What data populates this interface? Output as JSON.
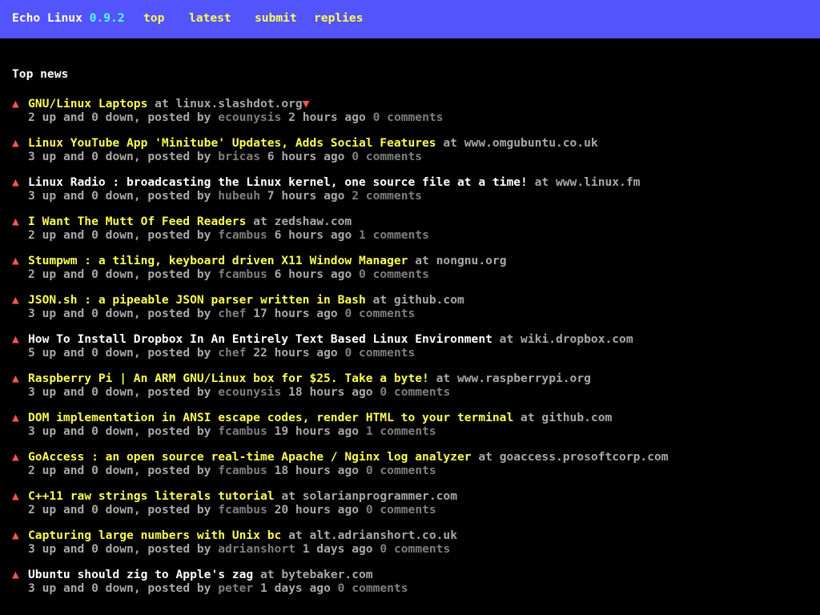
{
  "header": {
    "brand": "Echo Linux",
    "version": "0.9.2",
    "nav": [
      "top",
      "latest",
      "submit",
      "replies"
    ]
  },
  "section_title": "Top news",
  "colors": {
    "header_bg": "#5454fc",
    "link_yellow": "#fcfc54",
    "vote_red": "#fc5454",
    "version_cyan": "#54fcfc",
    "meta_gray": "#a8a8a8",
    "dim_gray": "#7f7f7f"
  },
  "icons": {
    "upvote": "▲",
    "downvote": "▼"
  },
  "news": [
    {
      "title": "GNU/Linux Laptops",
      "domain": "linux.slashdot.org",
      "white": false,
      "downvote": true,
      "up": "2",
      "down": "0",
      "user": "ecounysis",
      "time": "2 hours ago",
      "comments": "0 comments"
    },
    {
      "title": "Linux YouTube App 'Minitube' Updates, Adds Social Features",
      "domain": "www.omgubuntu.co.uk",
      "white": false,
      "downvote": false,
      "up": "3",
      "down": "0",
      "user": "bricas",
      "time": "6 hours ago",
      "comments": "0 comments"
    },
    {
      "title": "Linux Radio : broadcasting the Linux kernel, one source file at a time!",
      "domain": "www.linux.fm",
      "white": true,
      "downvote": false,
      "up": "3",
      "down": "0",
      "user": "hubeuh",
      "time": "7 hours ago",
      "comments": "2 comments"
    },
    {
      "title": "I Want The Mutt Of Feed Readers",
      "domain": "zedshaw.com",
      "white": false,
      "downvote": false,
      "up": "2",
      "down": "0",
      "user": "fcambus",
      "time": "6 hours ago",
      "comments": "1 comments"
    },
    {
      "title": "Stumpwm : a tiling, keyboard driven X11 Window Manager",
      "domain": "nongnu.org",
      "white": false,
      "downvote": false,
      "up": "2",
      "down": "0",
      "user": "fcambus",
      "time": "6 hours ago",
      "comments": "0 comments"
    },
    {
      "title": "JSON.sh : a pipeable JSON parser written in Bash",
      "domain": "github.com",
      "white": false,
      "downvote": false,
      "up": "3",
      "down": "0",
      "user": "chef",
      "time": "17 hours ago",
      "comments": "0 comments"
    },
    {
      "title": "How To Install Dropbox In An Entirely Text Based Linux Environment",
      "domain": "wiki.dropbox.com",
      "white": true,
      "downvote": false,
      "up": "5",
      "down": "0",
      "user": "chef",
      "time": "22 hours ago",
      "comments": "0 comments"
    },
    {
      "title": "Raspberry Pi | An ARM GNU/Linux box for $25. Take a byte!",
      "domain": "www.raspberrypi.org",
      "white": false,
      "downvote": false,
      "up": "3",
      "down": "0",
      "user": "ecounysis",
      "time": "18 hours ago",
      "comments": "0 comments"
    },
    {
      "title": "DOM implementation in ANSI escape codes, render HTML to your terminal",
      "domain": "github.com",
      "white": false,
      "downvote": false,
      "up": "3",
      "down": "0",
      "user": "fcambus",
      "time": "19 hours ago",
      "comments": "1 comments"
    },
    {
      "title": "GoAccess : an open source real-time Apache / Nginx log analyzer",
      "domain": "goaccess.prosoftcorp.com",
      "white": false,
      "downvote": false,
      "up": "2",
      "down": "0",
      "user": "fcambus",
      "time": "18 hours ago",
      "comments": "0 comments"
    },
    {
      "title": "C++11 raw strings literals tutorial",
      "domain": "solarianprogrammer.com",
      "white": false,
      "downvote": false,
      "up": "2",
      "down": "0",
      "user": "fcambus",
      "time": "20 hours ago",
      "comments": "0 comments"
    },
    {
      "title": "Capturing large numbers with Unix bc",
      "domain": "alt.adrianshort.co.uk",
      "white": false,
      "downvote": false,
      "up": "3",
      "down": "0",
      "user": "adrianshort",
      "time": "1 days ago",
      "comments": "0 comments"
    },
    {
      "title": "Ubuntu should zig to Apple's zag",
      "domain": "bytebaker.com",
      "white": true,
      "downvote": false,
      "up": "3",
      "down": "0",
      "user": "peter",
      "time": "1 days ago",
      "comments": "0 comments"
    }
  ]
}
